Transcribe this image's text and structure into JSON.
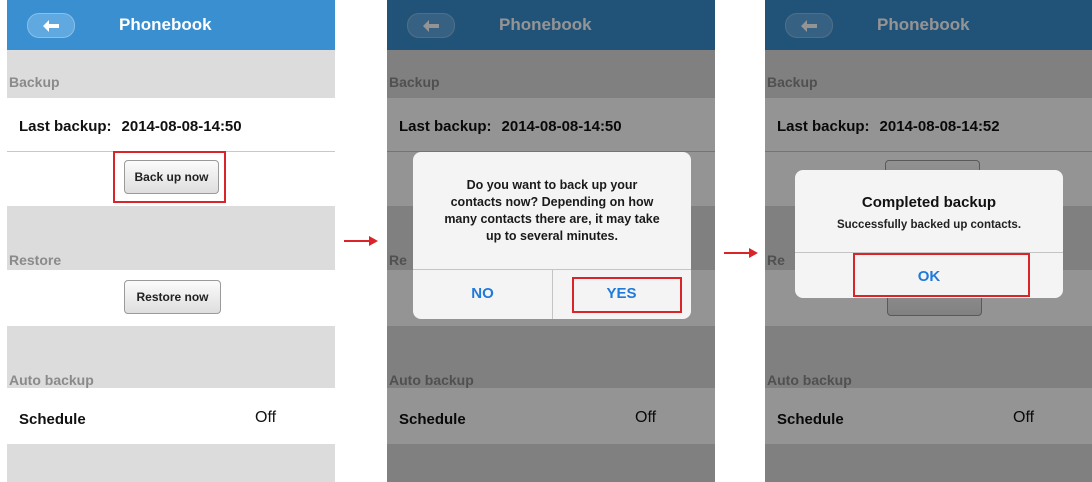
{
  "colors": {
    "header": "#3a8fd0",
    "highlight": "#d9242a",
    "dialog_button": "#1f7ad9"
  },
  "icons": {
    "back": "left-arrow-icon",
    "flow": "right-arrow-icon"
  },
  "screens": [
    {
      "header_title": "Phonebook",
      "backup_label": "Backup",
      "last_backup_label": "Last backup:",
      "last_backup_value": "2014-08-08-14:50",
      "back_up_button": "Back up now",
      "restore_label": "Restore",
      "restore_button": "Restore now",
      "auto_backup_label": "Auto backup",
      "schedule_label": "Schedule",
      "schedule_value": "Off"
    },
    {
      "header_title": "Phonebook",
      "backup_label": "Backup",
      "last_backup_label": "Last backup:",
      "last_backup_value": "2014-08-08-14:50",
      "restore_label_partial": "Re",
      "auto_backup_label": "Auto backup",
      "schedule_label": "Schedule",
      "schedule_value": "Off",
      "dialog": {
        "message_lines": [
          "Do you want to back up your",
          "contacts now? Depending on how",
          "many contacts there are, it may take",
          "up to several minutes."
        ],
        "no_label": "NO",
        "yes_label": "YES"
      }
    },
    {
      "header_title": "Phonebook",
      "backup_label": "Backup",
      "last_backup_label": "Last backup:",
      "last_backup_value": "2014-08-08-14:52",
      "restore_label_partial": "Re",
      "auto_backup_label": "Auto backup",
      "schedule_label": "Schedule",
      "schedule_value": "Off",
      "dialog": {
        "title": "Completed backup",
        "message": "Successfully backed up contacts.",
        "ok_label": "OK"
      }
    }
  ]
}
